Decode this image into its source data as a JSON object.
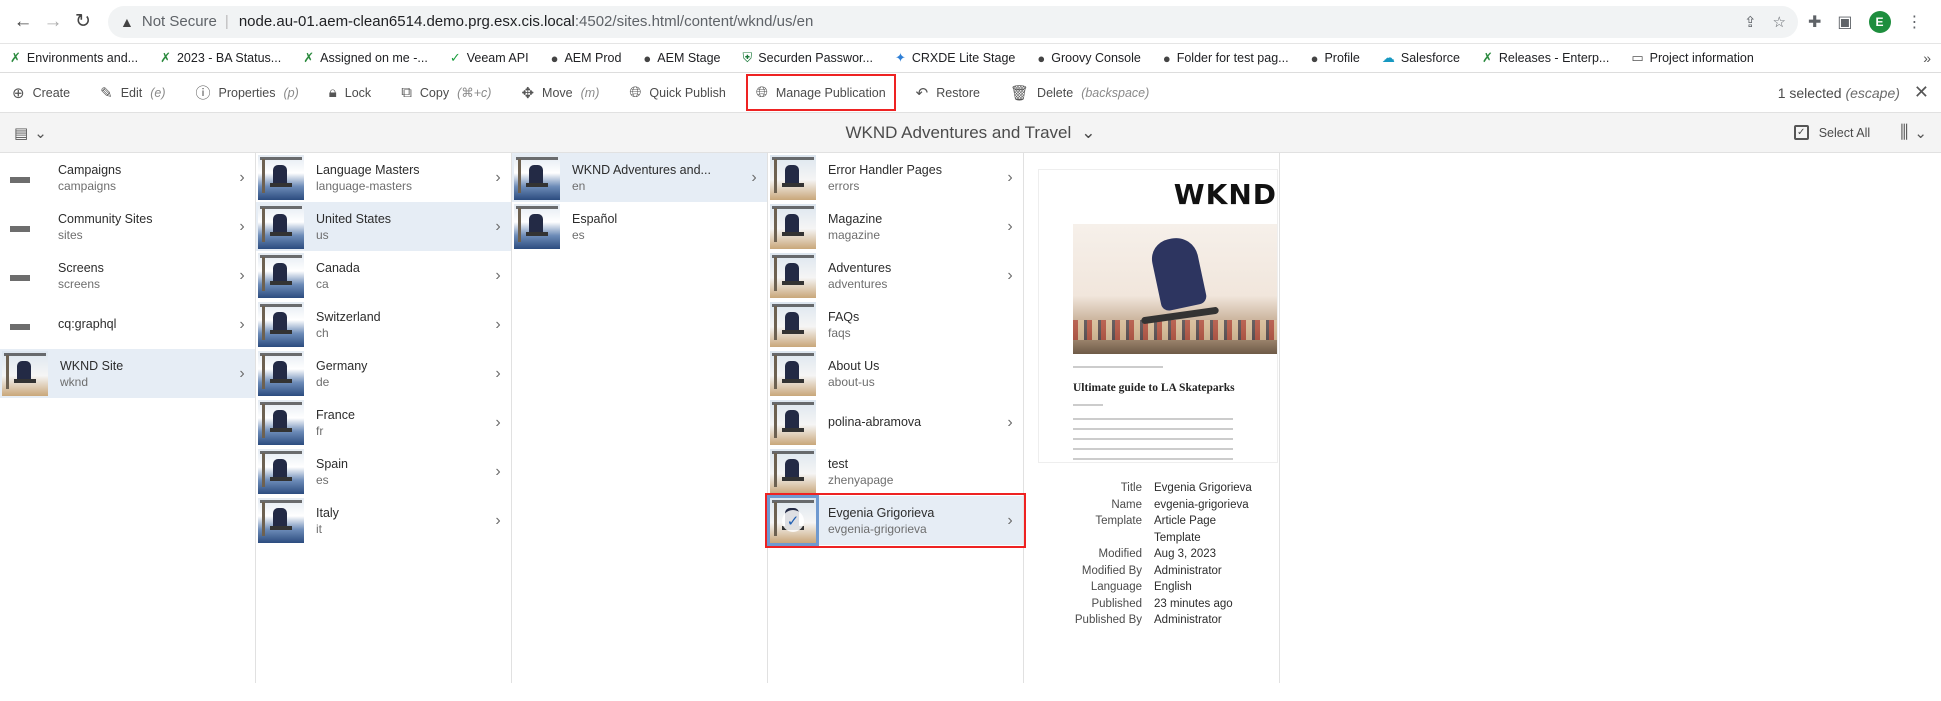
{
  "browser": {
    "not_secure": "Not Secure",
    "url_host": "node.au-01.aem-clean6514.demo.prg.esx.cis.local",
    "url_path": ":4502/sites.html/content/wknd/us/en",
    "profile_initial": "E"
  },
  "bookmarks": [
    {
      "label": "Environments and...",
      "icon": "x-icon"
    },
    {
      "label": "2023 - BA Status...",
      "icon": "x-icon"
    },
    {
      "label": "Assigned on me -...",
      "icon": "x-icon"
    },
    {
      "label": "Veeam API",
      "icon": "v-icon"
    },
    {
      "label": "AEM Prod",
      "icon": "globe-icon"
    },
    {
      "label": "AEM Stage",
      "icon": "globe-icon"
    },
    {
      "label": "Securden Passwor...",
      "icon": "shield-icon"
    },
    {
      "label": "CRXDE Lite Stage",
      "icon": "crx-icon"
    },
    {
      "label": "Groovy Console",
      "icon": "globe-icon"
    },
    {
      "label": "Folder for test pag...",
      "icon": "globe-icon"
    },
    {
      "label": "Profile",
      "icon": "globe-icon"
    },
    {
      "label": "Salesforce",
      "icon": "cloud-icon"
    },
    {
      "label": "Releases - Enterp...",
      "icon": "x-icon"
    },
    {
      "label": "Project information",
      "icon": "folder-icon"
    }
  ],
  "actionbar": {
    "create": "Create",
    "edit": "Edit",
    "edit_kbd": "(e)",
    "properties": "Properties",
    "properties_kbd": "(p)",
    "lock": "Lock",
    "copy": "Copy",
    "copy_kbd": "(⌘+c)",
    "move": "Move",
    "move_kbd": "(m)",
    "quick_publish": "Quick Publish",
    "manage_publication": "Manage Publication",
    "restore": "Restore",
    "delete": "Delete",
    "delete_kbd": "(backspace)",
    "selected": "1 selected",
    "selected_kbd": "(escape)"
  },
  "titlebar": {
    "title": "WKND Adventures and Travel",
    "select_all": "Select All"
  },
  "columns": {
    "col1": [
      {
        "title": "Campaigns",
        "name": "campaigns",
        "type": "folder"
      },
      {
        "title": "Community Sites",
        "name": "sites",
        "type": "folder"
      },
      {
        "title": "Screens",
        "name": "screens",
        "type": "folder"
      },
      {
        "title": "cq:graphql",
        "name": "",
        "type": "folder"
      },
      {
        "title": "WKND Site",
        "name": "wknd",
        "type": "page"
      }
    ],
    "col2": [
      {
        "title": "Language Masters",
        "name": "language-masters"
      },
      {
        "title": "United States",
        "name": "us"
      },
      {
        "title": "Canada",
        "name": "ca"
      },
      {
        "title": "Switzerland",
        "name": "ch"
      },
      {
        "title": "Germany",
        "name": "de"
      },
      {
        "title": "France",
        "name": "fr"
      },
      {
        "title": "Spain",
        "name": "es"
      },
      {
        "title": "Italy",
        "name": "it"
      }
    ],
    "col3": [
      {
        "title": "WKND Adventures and...",
        "name": "en"
      },
      {
        "title": "Español",
        "name": "es"
      }
    ],
    "col4": [
      {
        "title": "Error Handler Pages",
        "name": "errors"
      },
      {
        "title": "Magazine",
        "name": "magazine"
      },
      {
        "title": "Adventures",
        "name": "adventures"
      },
      {
        "title": "FAQs",
        "name": "faqs"
      },
      {
        "title": "About Us",
        "name": "about-us"
      },
      {
        "title": "polina-abramova",
        "name": ""
      },
      {
        "title": "test",
        "name": "zhenyapage"
      },
      {
        "title": "Evgenia Grigorieva",
        "name": "evgenia-grigorieva"
      }
    ]
  },
  "preview": {
    "logo": "WKND",
    "headline": "Ultimate guide to LA Skateparks",
    "meta": [
      {
        "k": "Title",
        "v": "Evgenia Grigorieva"
      },
      {
        "k": "Name",
        "v": "evgenia-grigorieva"
      },
      {
        "k": "Template",
        "v": "Article Page"
      },
      {
        "k": "",
        "v": "Template"
      },
      {
        "k": "Modified",
        "v": "Aug 3, 2023"
      },
      {
        "k": "Modified By",
        "v": "Administrator"
      },
      {
        "k": "Language",
        "v": "English"
      },
      {
        "k": "Published",
        "v": "23 minutes ago"
      },
      {
        "k": "Published By",
        "v": "Administrator"
      }
    ]
  },
  "colors": {
    "highlight_box": "#ee2222",
    "active_row": "#e6edf5",
    "selected_thumb": "#6f99cf"
  }
}
